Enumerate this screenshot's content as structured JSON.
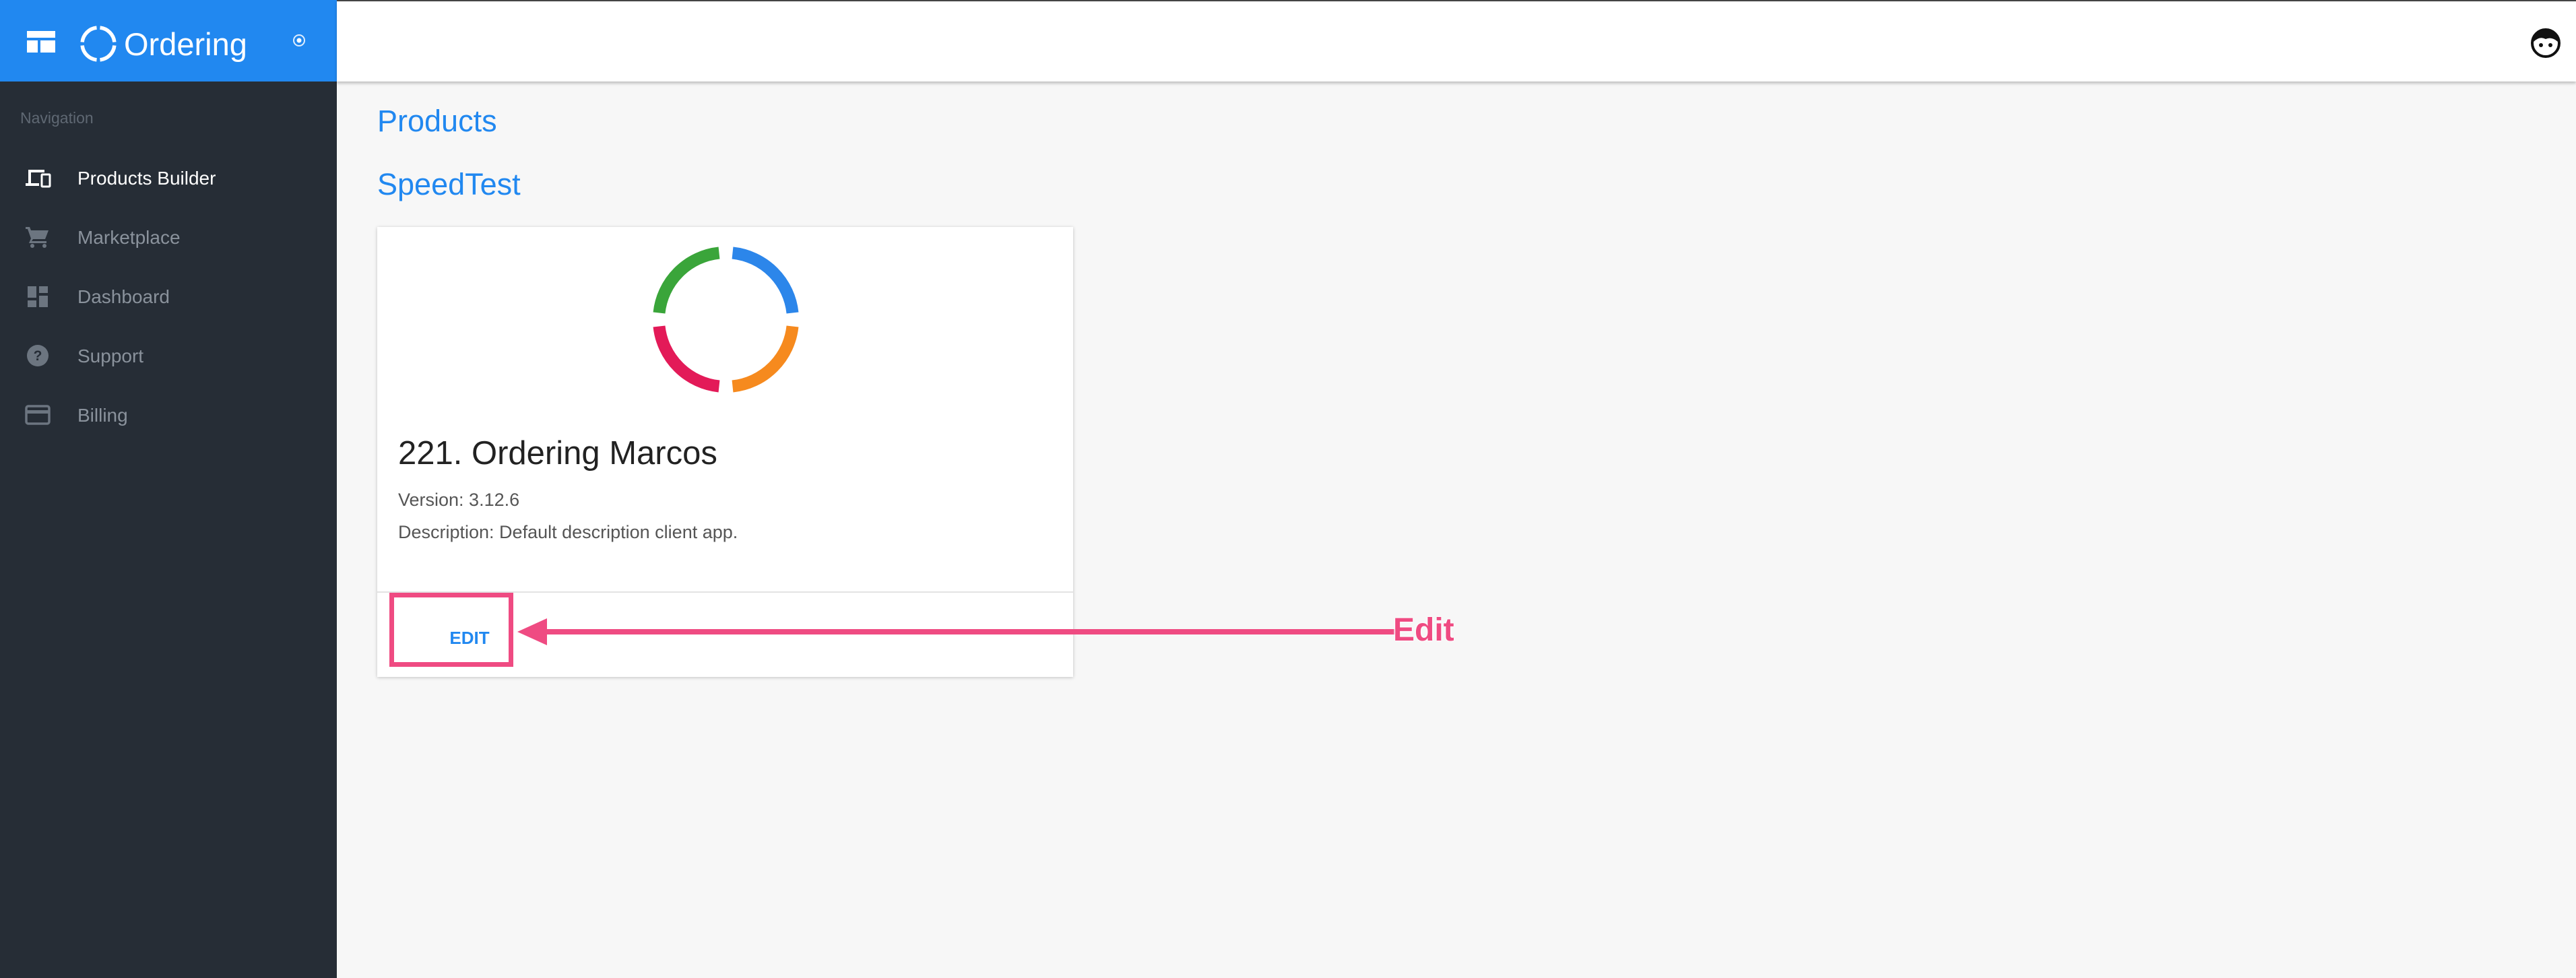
{
  "app": {
    "name": "Ordering",
    "colors": {
      "brand": "#2188f0",
      "sidebar": "#262d36",
      "accent": "#ef4b82"
    }
  },
  "sidebar": {
    "heading": "Navigation",
    "items": [
      {
        "label": "Products Builder",
        "icon": "devices-icon",
        "active": true
      },
      {
        "label": "Marketplace",
        "icon": "cart-icon",
        "active": false
      },
      {
        "label": "Dashboard",
        "icon": "dashboard-icon",
        "active": false
      },
      {
        "label": "Support",
        "icon": "help-circle-icon",
        "active": false
      },
      {
        "label": "Billing",
        "icon": "credit-card-icon",
        "active": false
      }
    ]
  },
  "topbar": {
    "avatar_icon": "user-avatar-icon"
  },
  "main": {
    "page_title": "Products",
    "section_title": "SpeedTest",
    "product": {
      "title": "221. Ordering Marcos",
      "version": "Version: 3.12.6",
      "description": "Description: Default description client app.",
      "edit_label": "EDIT",
      "logo_icon": "ordering-ring-logo"
    }
  },
  "annotation": {
    "label": "Edit"
  }
}
